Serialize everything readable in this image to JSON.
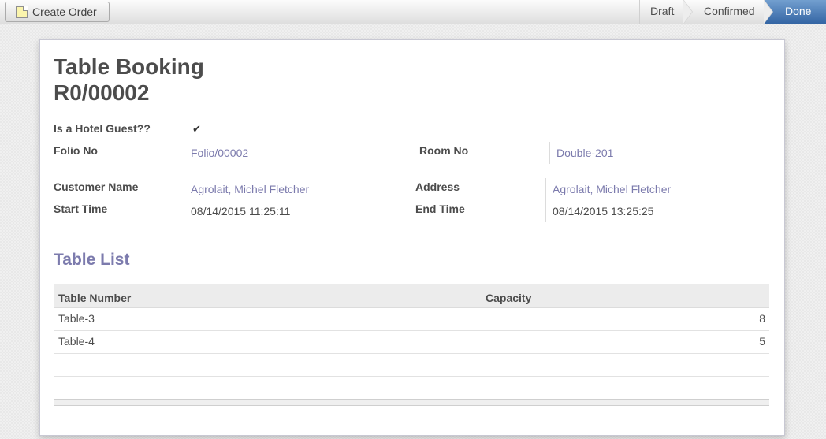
{
  "toolbar": {
    "create_button_label": "Create Order",
    "create_button_icon": "new-note-icon"
  },
  "statusbar": {
    "steps": [
      {
        "label": "Draft",
        "active": false
      },
      {
        "label": "Confirmed",
        "active": false
      },
      {
        "label": "Done",
        "active": true
      }
    ],
    "active_color": "#3465a4"
  },
  "form": {
    "title_line1": "Table Booking",
    "title_line2": "R0/00002",
    "fields": {
      "hotel_guest": {
        "label": "Is a Hotel Guest??",
        "checked": true,
        "check_glyph": "✔"
      },
      "folio_no": {
        "label": "Folio No",
        "value": "Folio/00002"
      },
      "room_no": {
        "label": "Room No",
        "value": "Double-201"
      },
      "customer_name": {
        "label": "Customer Name",
        "value": "Agrolait, Michel Fletcher"
      },
      "address": {
        "label": "Address",
        "value": "Agrolait, Michel Fletcher"
      },
      "start_time": {
        "label": "Start Time",
        "value": "08/14/2015 11:25:11"
      },
      "end_time": {
        "label": "End Time",
        "value": "08/14/2015 13:25:25"
      }
    },
    "link_color": "#7c7bad"
  },
  "table_list": {
    "title": "Table List",
    "columns": [
      "Table Number",
      "Capacity"
    ],
    "rows": [
      {
        "table_number": "Table-3",
        "capacity": "8"
      },
      {
        "table_number": "Table-4",
        "capacity": "5"
      }
    ]
  }
}
